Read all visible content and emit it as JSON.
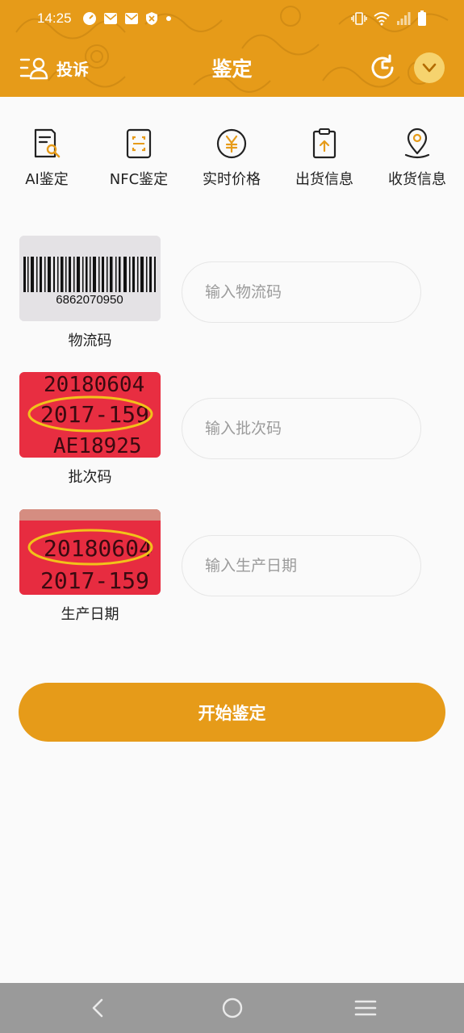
{
  "status": {
    "time": "14:25"
  },
  "header": {
    "complaint_label": "投诉",
    "title": "鉴定"
  },
  "features": [
    {
      "label": "AI鉴定",
      "icon": "ai-search-icon"
    },
    {
      "label": "NFC鉴定",
      "icon": "nfc-scan-icon"
    },
    {
      "label": "实时价格",
      "icon": "yen-icon"
    },
    {
      "label": "出货信息",
      "icon": "clipboard-upload-icon"
    },
    {
      "label": "收货信息",
      "icon": "location-pin-icon"
    }
  ],
  "rows": [
    {
      "label": "物流码",
      "placeholder": "输入物流码",
      "sample_text": "6862070950"
    },
    {
      "label": "批次码",
      "placeholder": "输入批次码",
      "sample_lines": [
        "20180604",
        "2017-159",
        "AE18925"
      ]
    },
    {
      "label": "生产日期",
      "placeholder": "输入生产日期",
      "sample_lines": [
        "20180604",
        "2017-159"
      ]
    }
  ],
  "start_button": "开始鉴定",
  "colors": {
    "brand": "#E69B19",
    "accent_light": "#F6D36E"
  }
}
